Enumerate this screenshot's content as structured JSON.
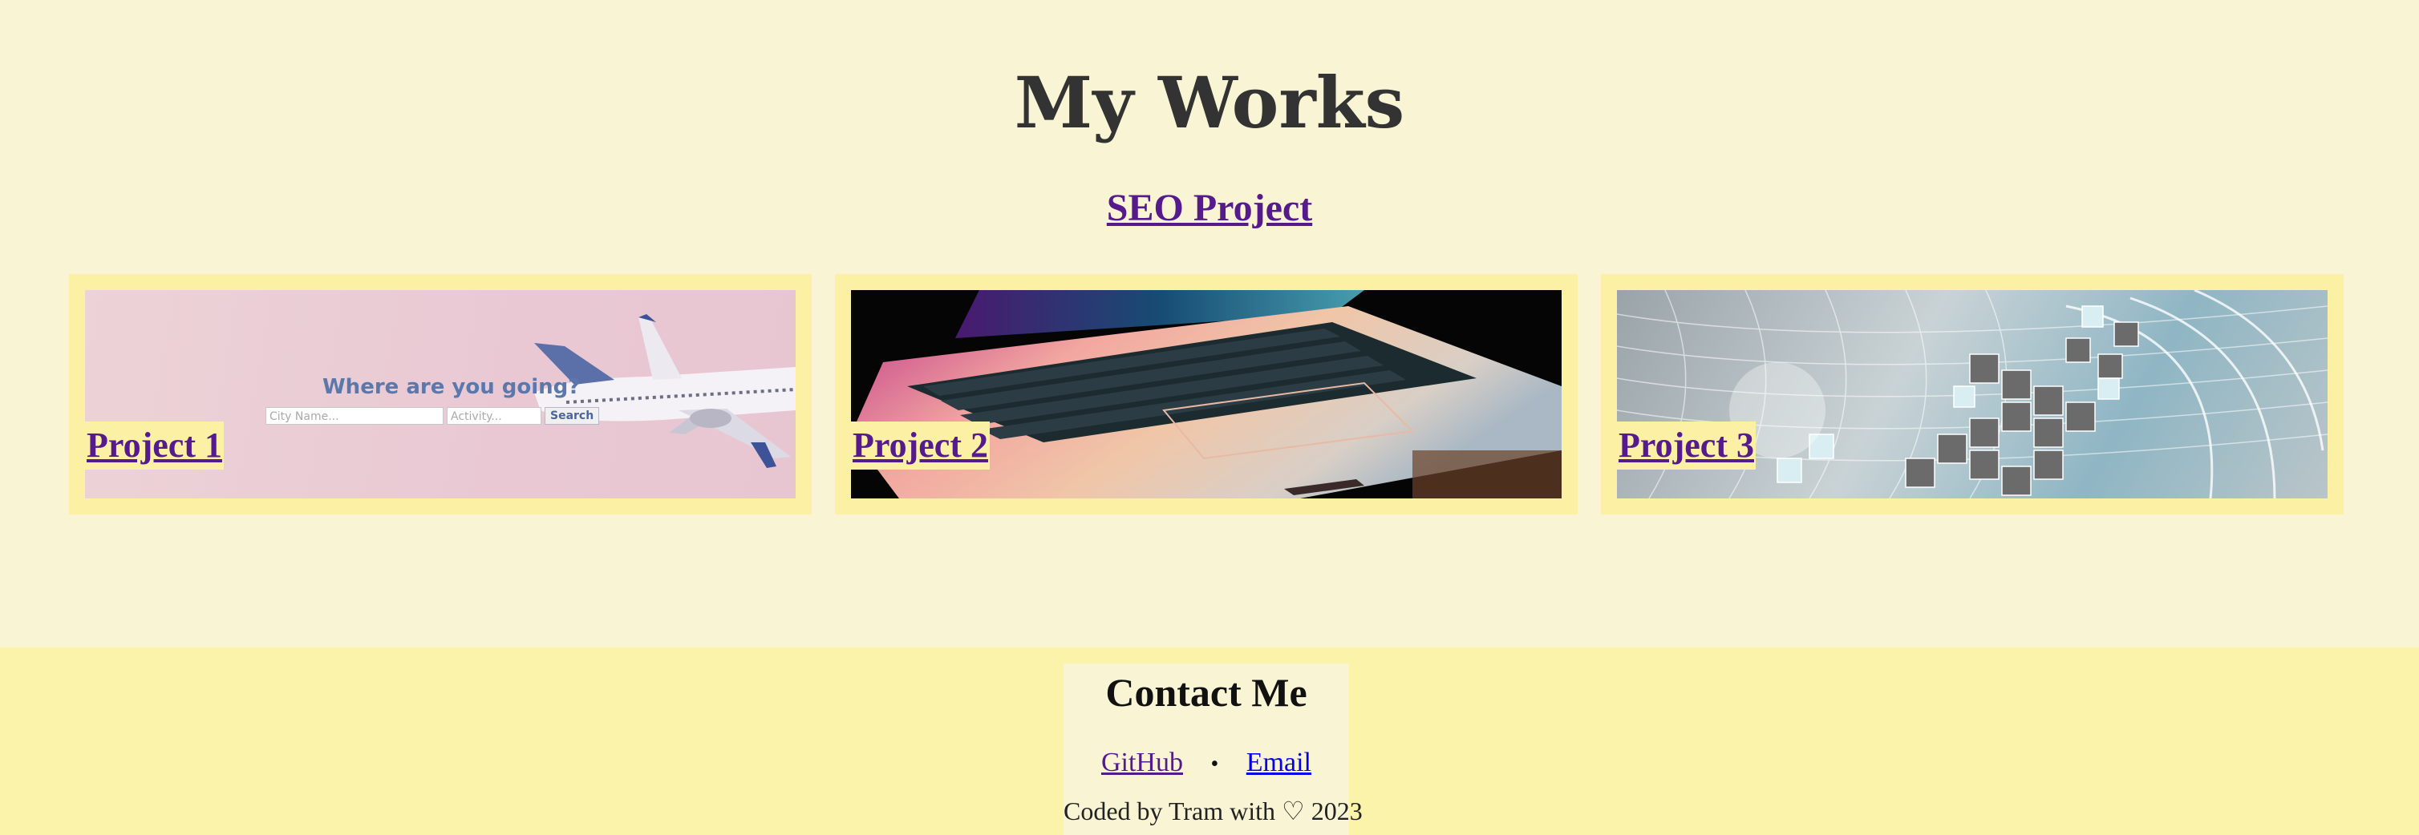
{
  "header": {
    "title": "My Works"
  },
  "section": {
    "link_label": "SEO Project"
  },
  "projects": [
    {
      "label": "Project 1",
      "preview": {
        "question": "Where are you going?",
        "city_placeholder": "City Name...",
        "activity_placeholder": "Activity...",
        "search_label": "Search"
      }
    },
    {
      "label": "Project 2"
    },
    {
      "label": "Project 3"
    }
  ],
  "footer": {
    "title": "Contact Me",
    "links": [
      {
        "label": "GitHub"
      },
      {
        "label": "Email"
      }
    ],
    "separator": "•",
    "credit": "Coded by Tram with ♡ 2023"
  },
  "colors": {
    "page_bg": "#f9f5d4",
    "card_bg": "#fbf0a4",
    "footer_bg": "#fbf3a9",
    "visited_link": "#551a8b",
    "link": "#0000ee"
  }
}
